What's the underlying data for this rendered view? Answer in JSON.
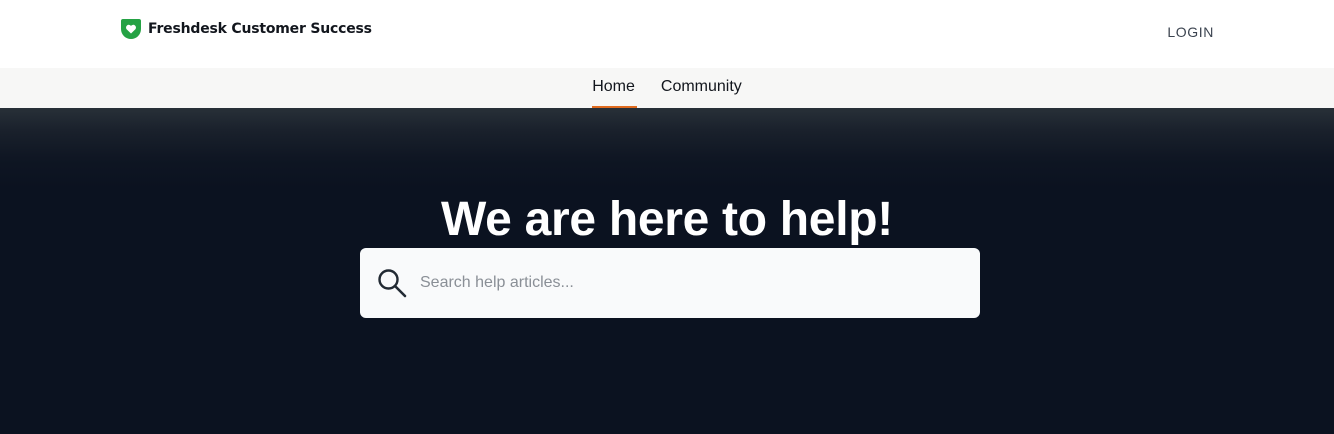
{
  "header": {
    "brand_name": "Freshdesk Customer Success",
    "login_label": "LOGIN"
  },
  "nav": {
    "tabs": [
      {
        "label": "Home",
        "active": true
      },
      {
        "label": "Community",
        "active": false
      }
    ]
  },
  "hero": {
    "title": "We are here to help!",
    "search": {
      "placeholder": "Search help articles...",
      "value": "",
      "icon": "search-icon"
    }
  },
  "colors": {
    "brand_green": "#25a244",
    "accent_orange": "#e06b1f",
    "hero_background": "#0b1220",
    "nav_background": "#f7f7f6"
  }
}
